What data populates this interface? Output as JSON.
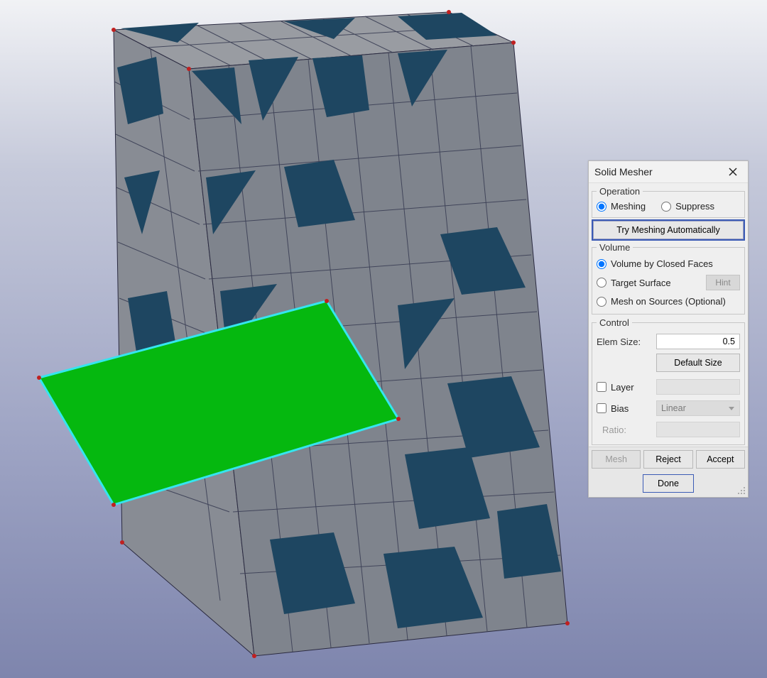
{
  "panel": {
    "title": "Solid Mesher",
    "operation": {
      "legend": "Operation",
      "meshing": "Meshing",
      "suppress": "Suppress",
      "selected": "meshing"
    },
    "auto_button": "Try Meshing Automatically",
    "volume": {
      "legend": "Volume",
      "closed_faces": "Volume by Closed Faces",
      "target_surface": "Target Surface",
      "hint_label": "Hint",
      "mesh_on_sources": "Mesh on Sources (Optional)",
      "selected": "closed_faces"
    },
    "control": {
      "legend": "Control",
      "elem_size_label": "Elem Size:",
      "elem_size_value": "0.5",
      "default_size": "Default Size",
      "layer_label": "Layer",
      "layer_value": "",
      "bias_label": "Bias",
      "bias_select": "Linear",
      "ratio_label": "Ratio:",
      "ratio_value": ""
    },
    "actions": {
      "mesh": "Mesh",
      "reject": "Reject",
      "accept": "Accept",
      "done": "Done"
    }
  }
}
